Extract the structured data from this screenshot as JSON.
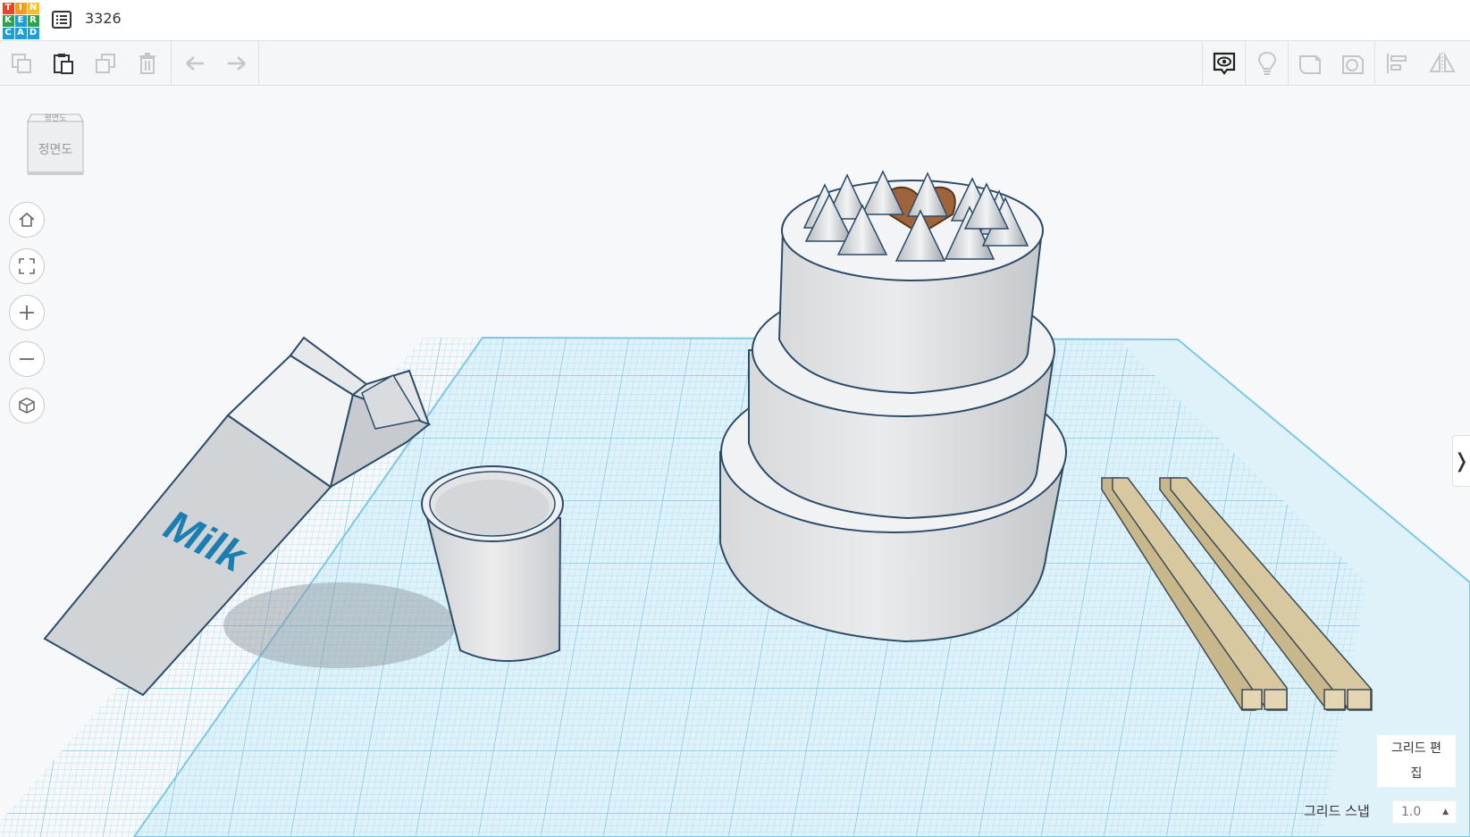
{
  "app": {
    "logo_letters": [
      "T",
      "I",
      "N",
      "K",
      "E",
      "R",
      "C",
      "A",
      "D"
    ],
    "logo_colors": [
      "#e8442b",
      "#f79b1c",
      "#f6c11c",
      "#2fa34b",
      "#1e9fd4",
      "#2fa34b",
      "#1e9fd4",
      "#1e9fd4",
      "#1e9fd4"
    ],
    "document_title": "3326"
  },
  "toolbar": {
    "left_icons": [
      "copy-icon",
      "paste-icon",
      "duplicate-icon",
      "delete-icon",
      "undo-icon",
      "redo-icon"
    ],
    "right_icons": [
      "notes-visibility-icon",
      "light-bulb-icon",
      "shape-icon",
      "hole-icon",
      "align-icon",
      "mirror-icon"
    ]
  },
  "viewcube": {
    "top_label": "평면도",
    "front_label": "정면도"
  },
  "nav_controls": [
    "home-icon",
    "fit-all-icon",
    "zoom-in-icon",
    "zoom-out-icon",
    "perspective-icon"
  ],
  "scene": {
    "milk_label": "Milk",
    "accent_color": "#1a7fb0",
    "grid_color": "#8ed0ea",
    "heart_color": "#a0643a",
    "chopstick_color": "#d3c29a"
  },
  "grid_panel": {
    "edit_label_line1": "그리드 편",
    "edit_label_line2": "집",
    "snap_label": "그리드 스냅",
    "snap_value": "1.0"
  }
}
